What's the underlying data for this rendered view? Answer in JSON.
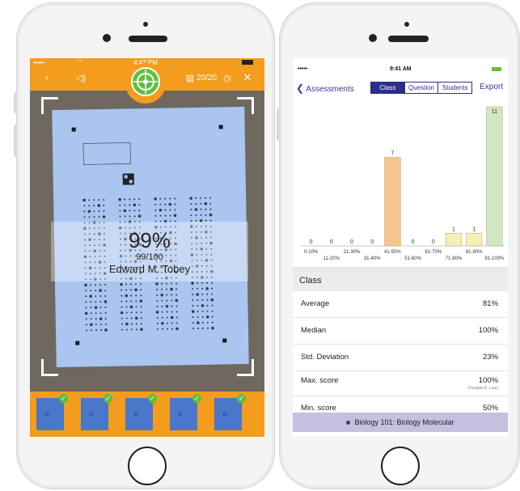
{
  "left_app": {
    "status": {
      "carrier": "•••••",
      "time": "4:43 PM"
    },
    "toolbar": {
      "counter": "20/20"
    },
    "result": {
      "percent": "99%",
      "score": "99/100",
      "name": "Edward M. Tobey"
    },
    "thumbnails": 5,
    "colors": {
      "accent": "#f39c1d",
      "scan": "#5fbf3c",
      "paper": "#a9c5f0"
    },
    "icons": [
      "bulb-icon",
      "sound-icon",
      "scan-target-icon",
      "document-icon",
      "close-icon",
      "magnify-icon",
      "check-icon"
    ]
  },
  "right_app": {
    "status": {
      "carrier": "•••••",
      "time": "9:41 AM"
    },
    "nav": {
      "back_label": "Assessments",
      "tabs": [
        "Class",
        "Question",
        "Students"
      ],
      "active_tab": "Class",
      "export_label": "Export"
    },
    "chart_data": {
      "type": "bar",
      "categories": [
        "0-10%",
        "11-20%",
        "21-30%",
        "31-40%",
        "41-50%",
        "51-60%",
        "61-70%",
        "71-80%",
        "81-90%",
        "91-100%"
      ],
      "values": [
        0,
        0,
        0,
        0,
        7,
        0,
        0,
        1,
        1,
        11
      ],
      "data_labels": [
        "0",
        "0",
        "0",
        "0",
        "7",
        "0",
        "0",
        "1",
        "1",
        "11"
      ],
      "bar_colors": [
        "#f4c58e",
        "#f4c58e",
        "#f4c58e",
        "#f4c58e",
        "#f4c58e",
        "#f4c58e",
        "#f4c58e",
        "#f1f0b8",
        "#f1f0b8",
        "#cfe8c2"
      ],
      "ylim": [
        0,
        11
      ]
    },
    "section_title": "Class",
    "stats": [
      {
        "label": "Average",
        "value": "81%"
      },
      {
        "label": "Median",
        "value": "100%"
      },
      {
        "label": "Std. Deviation",
        "value": "23%"
      },
      {
        "label": "Max. score",
        "value": "100%",
        "note": "Douglas E. Lauri"
      },
      {
        "label": "Min. score",
        "value": "50%"
      }
    ],
    "footer_label": "Biology 101: Biology Molecular",
    "colors": {
      "accent": "#2d2d8a",
      "footer": "#c4c0e0"
    }
  }
}
